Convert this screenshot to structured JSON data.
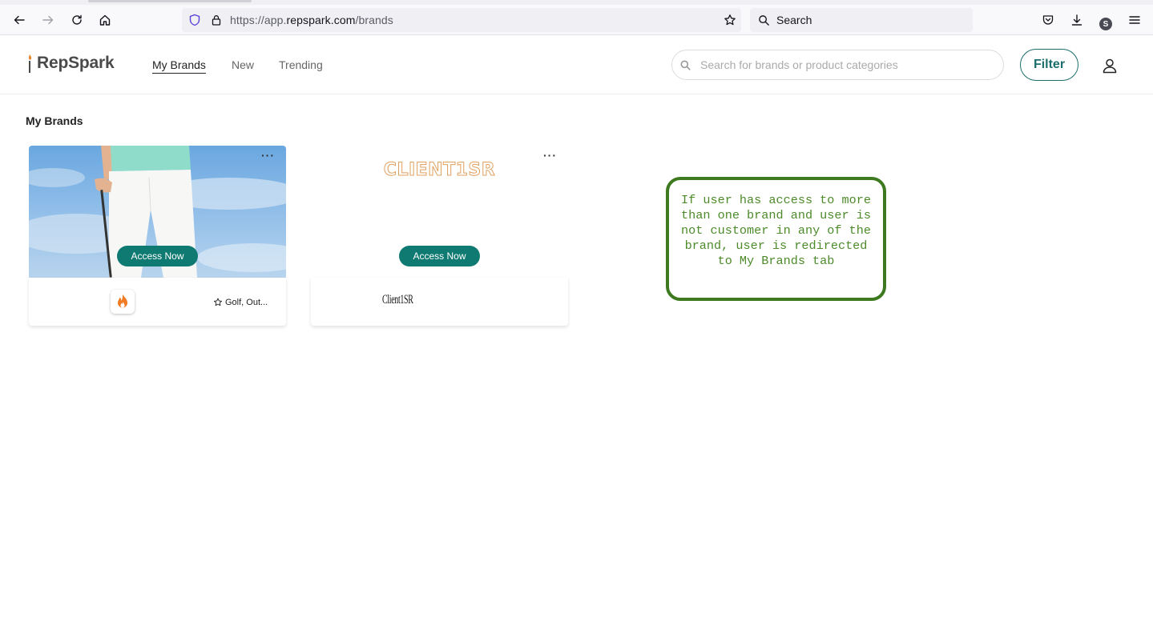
{
  "browser": {
    "url_prefix": "https://app.",
    "url_host": "repspark.com",
    "url_path": "/brands",
    "search_placeholder": "Search",
    "profile_initial": "S"
  },
  "app": {
    "logo_text": "RepSpark",
    "nav": [
      {
        "label": "My Brands",
        "active": true
      },
      {
        "label": "New",
        "active": false
      },
      {
        "label": "Trending",
        "active": false
      }
    ],
    "search_placeholder": "Search for brands or product categories",
    "filter_label": "Filter"
  },
  "content": {
    "section_title": "My Brands",
    "cards": [
      {
        "more_label": "···",
        "access_label": "Access Now",
        "tags": "Golf, Out..."
      },
      {
        "more_label": "···",
        "access_label": "Access Now",
        "wordmark": "CLIENT1SR",
        "mini_label": "Client1SR"
      }
    ],
    "note": "If user has access to more than one brand and user is not customer in any of the brand, user is redirected to My Brands tab"
  },
  "colors": {
    "accent": "#0f7a72",
    "filter_border": "#1b6e6b",
    "note_border": "#3d7a1f",
    "note_text": "#4d8a2a"
  }
}
